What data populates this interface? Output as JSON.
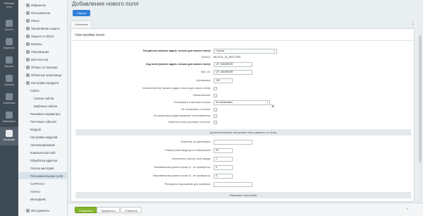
{
  "rail": {
    "top_label": "Рабочий стол",
    "items": [
      {
        "label": "Контент",
        "icon": "content-icon"
      },
      {
        "label": "Маркетинг",
        "icon": "marketing-icon"
      },
      {
        "label": "Магазин",
        "icon": "store-icon"
      },
      {
        "label": "Сервисы",
        "icon": "services-icon"
      },
      {
        "label": "Аналитика",
        "icon": "analytics-icon"
      },
      {
        "label": "Marketplace",
        "icon": "marketplace-icon"
      },
      {
        "label": "Настройки",
        "icon": "settings-icon"
      }
    ]
  },
  "menu": {
    "items": [
      {
        "label": "Избранное",
        "level": 1
      },
      {
        "label": "Пользователи",
        "level": 1
      },
      {
        "label": "Поиск",
        "level": 1
      },
      {
        "label": "Проактивная защита",
        "level": 1
      },
      {
        "label": "Защита от DDoS",
        "level": 1
      },
      {
        "label": "Валюты",
        "level": 1
      },
      {
        "label": "Локализация",
        "level": 1
      },
      {
        "label": "Веб-кластер",
        "level": 1
      },
      {
        "label": "Облако 1С-Битрикс",
        "level": 1
      },
      {
        "label": "Облачные хранилища",
        "level": 1
      },
      {
        "label": "Настройки продукта",
        "level": 1
      },
      {
        "label": "Сайты",
        "level": 2
      },
      {
        "label": "Список сайтов",
        "level": 3
      },
      {
        "label": "Шаблоны сайтов",
        "level": 3
      },
      {
        "label": "Языковые параметры",
        "level": 2
      },
      {
        "label": "Почтовые события",
        "level": 2
      },
      {
        "label": "Модули",
        "level": 2
      },
      {
        "label": "Настройки модулей",
        "level": 2
      },
      {
        "label": "Автокэширование",
        "level": 2
      },
      {
        "label": "Композитный сайт",
        "level": 2
      },
      {
        "label": "Обработка адресов",
        "level": 2
      },
      {
        "label": "Список мастеров",
        "level": 2
      },
      {
        "label": "Пользовательские поля",
        "level": 2,
        "selected": true
      },
      {
        "label": "CAPTCHA",
        "level": 2
      },
      {
        "label": "Агенты",
        "level": 2
      },
      {
        "label": "Интерфейс",
        "level": 2
      },
      {
        "label": "Инструменты",
        "level": 1
      }
    ]
  },
  "header": {
    "title": "Добавление нового поля",
    "list_button": "Список"
  },
  "tab": {
    "label": "Основные"
  },
  "panel": {
    "title": "Настройки поля",
    "fields": {
      "data_type_label": "Тип данных (можно задать только для нового поля):",
      "data_type_value": "Строка",
      "object_label": "Объект:",
      "object_value": "IBLOCK_16_SECTION",
      "field_code_label": "Код поля (можно задать только для нового поля):",
      "field_code_value": "UF_SMARKER",
      "xml_id_label": "XML_ID:",
      "xml_id_value": "UF_SMARKER",
      "sort_label": "Сортировка:",
      "sort_value": "100",
      "multiple_label": "Множественное (можно задать только для нового поля):",
      "required_label": "Обязательное:",
      "filter_label": "Показывать в фильтре списка:",
      "filter_value": "не показывать",
      "hide_list_label": "Не показывать в списке:",
      "no_edit_label": "Не разрешать редактирование пользователем:",
      "search_label": "Значения поля участвуют в поиске:"
    },
    "extra_section": "Дополнительные настройки поля (зависят от типа)",
    "extra": {
      "default_label": "Значение по умолчанию:",
      "default_value": "",
      "size_label": "Размер поля ввода для отображения:",
      "size_value": "20",
      "rows_label": "Количество строчек поля ввода:",
      "rows_value": "1",
      "min_label": "Минимальная длина строки (0 - не проверять):",
      "min_value": "0",
      "max_label": "Максимальная длина строки (0 - не проверять):",
      "max_value": "0",
      "regex_label": "Регулярное выражение для проверки:",
      "regex_value": ""
    },
    "lang_section": "Языковые настройки"
  },
  "footer": {
    "save": "Сохранить",
    "apply": "Применить",
    "cancel": "Отменить"
  },
  "colors": {
    "rail_bg": "#3e4a54",
    "primary_button": "#2f7fd6",
    "save_button": "#83b52a"
  }
}
